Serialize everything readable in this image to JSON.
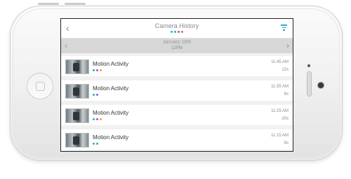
{
  "header": {
    "title": "Camera History",
    "back_icon": "chevron-left-icon",
    "filter_icon": "filter-icon",
    "dot_colors": [
      "#2fa9c9",
      "#2fa9c9",
      "#9b59d0",
      "#e85a8a"
    ]
  },
  "datebar": {
    "date": "January 16th",
    "time": "12PM",
    "prev_icon": "chevron-left-icon",
    "next_icon": "chevron-right-icon"
  },
  "rows": [
    {
      "label": "Motion Activity",
      "time": "11:45 AM",
      "duration": "12s",
      "dots": [
        "#2fa9c9",
        "#9b59d0",
        "#f0a030"
      ]
    },
    {
      "label": "Motion Activity",
      "time": "11:35 AM",
      "duration": "9s",
      "dots": [
        "#2fa9c9",
        "#9b59d0"
      ]
    },
    {
      "label": "Motion Activity",
      "time": "11:25 AM",
      "duration": "20s",
      "dots": [
        "#2fa9c9",
        "#9b59d0",
        "#f0a030"
      ]
    },
    {
      "label": "Motion Activity",
      "time": "11:15 AM",
      "duration": "9s",
      "dots": [
        "#2fa9c9",
        "#2fa9c9"
      ]
    }
  ],
  "accent_color": "#2fa9c9"
}
